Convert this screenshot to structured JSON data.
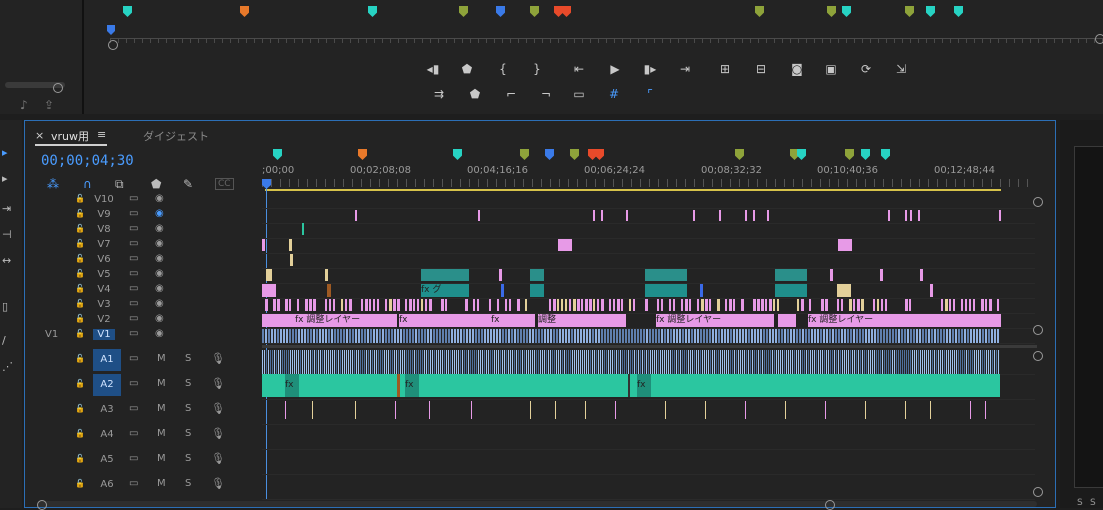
{
  "program_monitor": {
    "transport_row1": [
      "mark-in",
      "mark-out",
      "go-to-in",
      "go-to-out",
      "step-back",
      "play",
      "step-forward",
      "go-to-out-point",
      "lift",
      "extract",
      "export-frame",
      "compare",
      "replace",
      "export"
    ],
    "transport_row2": [
      "insert",
      "overwrite",
      "trim-in",
      "trim-out",
      "safe-margins",
      "grid",
      "snap"
    ]
  },
  "timeline": {
    "tab_label": "vruw用",
    "tab_menu": "≡",
    "tab_close": "×",
    "tab2_label": "ダイジェスト",
    "timecode": "00;00;04;30",
    "ruler_ticks": [
      ";00;00",
      "00;02;08;08",
      "00;04;16;16",
      "00;06;24;24",
      "00;08;32;32",
      "00;10;40;36",
      "00;12;48;44"
    ],
    "video_tracks": [
      "V10",
      "V9",
      "V8",
      "V7",
      "V6",
      "V5",
      "V4",
      "V3",
      "V2",
      "V1"
    ],
    "source_patch_v": "V1",
    "audio_tracks": [
      "A1",
      "A2",
      "A3",
      "A4",
      "A5",
      "A6"
    ],
    "audio_mute": "M",
    "audio_solo": "S",
    "clip_labels": {
      "v4_clip": "グ",
      "adj1": "調整レイヤー",
      "adj2": "調整",
      "adj3": "調整レイヤー",
      "adj4": "調整レイヤー",
      "fx": "fx"
    }
  },
  "meters": {
    "left": "S",
    "right": "S"
  },
  "colors": {
    "accent": "#2c6fb6",
    "timecode": "#4a9cff",
    "marker_cyan": "#27d3c3",
    "marker_orange": "#e8792a",
    "marker_olive": "#8ea33a",
    "marker_blue": "#3a7ae8",
    "marker_red": "#e84a2a",
    "clip_pink": "#e79ae7",
    "clip_teal": "#2bc6a0",
    "clip_audio": "#8fb0e0"
  }
}
